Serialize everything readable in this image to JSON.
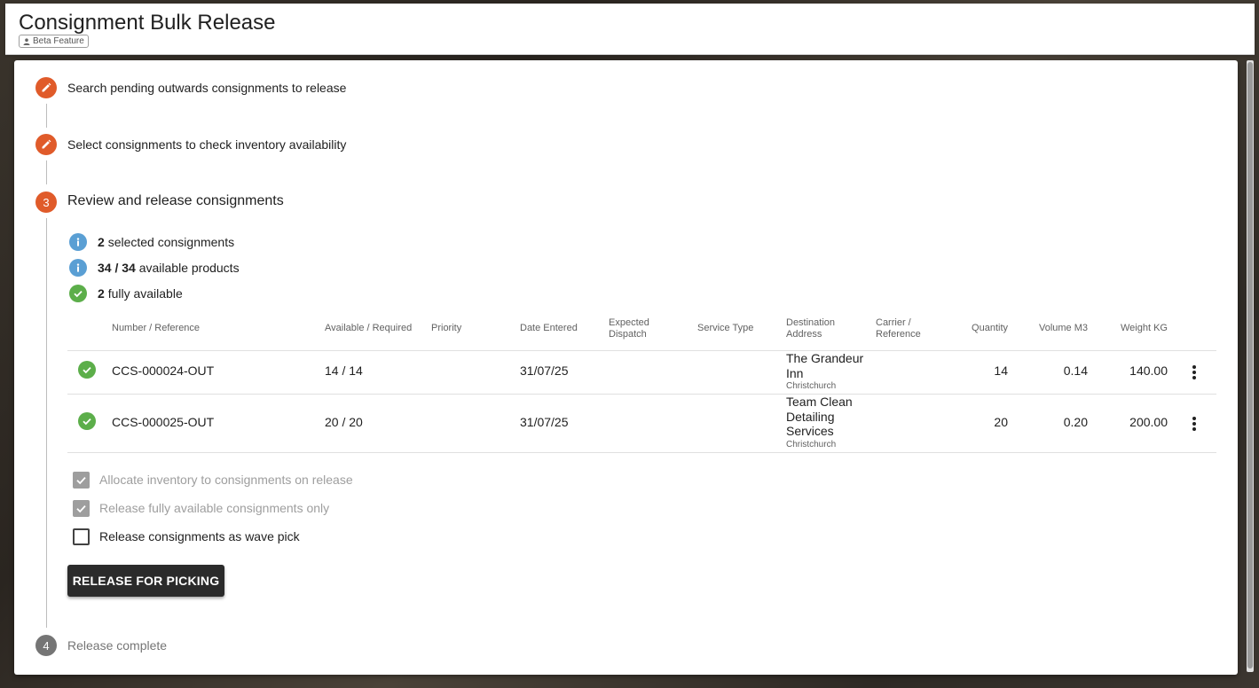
{
  "header": {
    "title": "Consignment Bulk Release",
    "badge": "Beta Feature"
  },
  "steps": [
    {
      "marker": "edit-icon",
      "label": "Search pending outwards consignments to release"
    },
    {
      "marker": "edit-icon",
      "label": "Select consignments to check inventory availability"
    },
    {
      "marker": "3",
      "label": "Review and release consignments"
    },
    {
      "marker": "4",
      "label": "Release complete"
    }
  ],
  "summary": [
    {
      "icon": "info-icon",
      "value": "2",
      "text": "selected consignments"
    },
    {
      "icon": "info-icon",
      "value": "34 / 34",
      "text": "available products"
    },
    {
      "icon": "check-circle-icon",
      "value": "2",
      "text": "fully available"
    }
  ],
  "table": {
    "headers": {
      "number": "Number / Reference",
      "available": "Available / Required",
      "priority": "Priority",
      "date_entered": "Date Entered",
      "expected_dispatch_1": "Expected",
      "expected_dispatch_2": "Dispatch",
      "service_type": "Service Type",
      "destination_1": "Destination",
      "destination_2": "Address",
      "carrier_1": "Carrier /",
      "carrier_2": "Reference",
      "quantity": "Quantity",
      "volume": "Volume M3",
      "weight": "Weight KG"
    },
    "rows": [
      {
        "number": "CCS-000024-OUT",
        "available": "14 / 14",
        "priority": "",
        "date_entered": "31/07/25",
        "expected_dispatch": "",
        "service_type": "",
        "destination_lines": [
          "The Grandeur",
          "Inn"
        ],
        "destination_city": "Christchurch",
        "carrier": "",
        "quantity": "14",
        "volume": "0.14",
        "weight": "140.00"
      },
      {
        "number": "CCS-000025-OUT",
        "available": "20 / 20",
        "priority": "",
        "date_entered": "31/07/25",
        "expected_dispatch": "",
        "service_type": "",
        "destination_lines": [
          "Team Clean",
          "Detailing",
          "Services"
        ],
        "destination_city": "Christchurch",
        "carrier": "",
        "quantity": "20",
        "volume": "0.20",
        "weight": "200.00"
      }
    ]
  },
  "options": [
    {
      "label": "Allocate inventory to consignments on release",
      "checked": true,
      "disabled": true
    },
    {
      "label": "Release fully available consignments only",
      "checked": true,
      "disabled": true
    },
    {
      "label": "Release consignments as wave pick",
      "checked": false,
      "disabled": false
    }
  ],
  "release_button": "RELEASE FOR PICKING",
  "colors": {
    "step_active": "#e05b2a",
    "step_inactive": "#757575",
    "info": "#5a9fd4",
    "success": "#5cae4a",
    "button": "#2b2b2b"
  }
}
